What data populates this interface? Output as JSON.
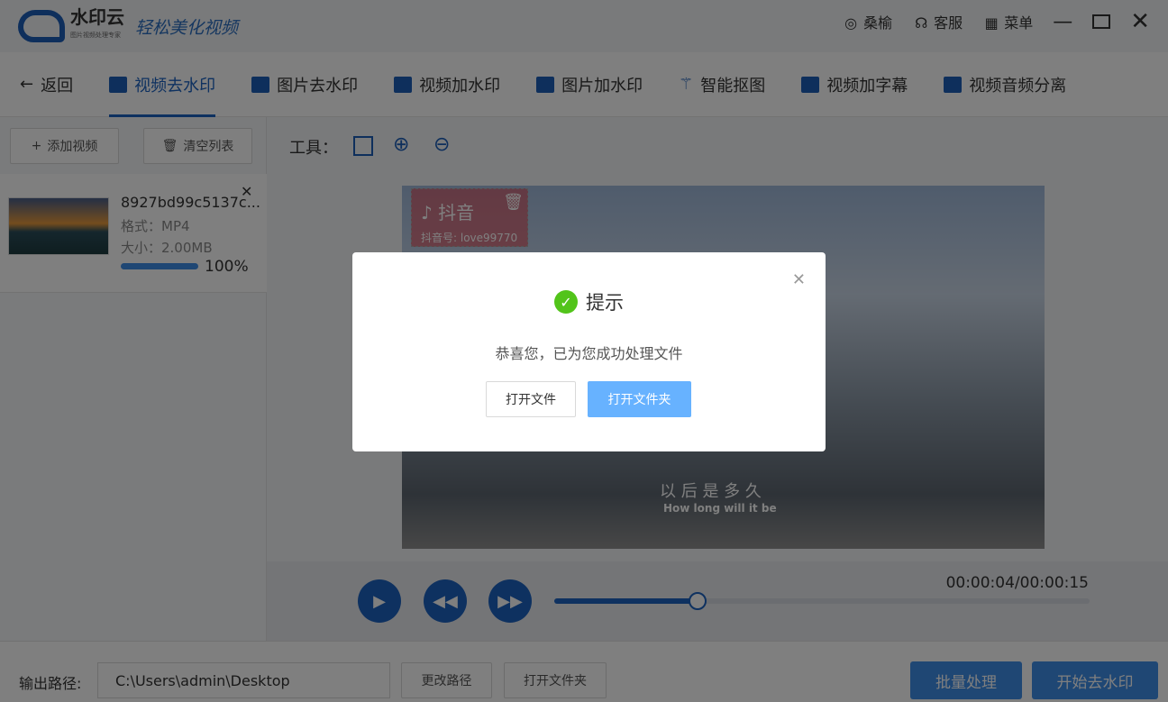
{
  "app": {
    "brand": "水印云",
    "brand_sub": "图片视频处理专家",
    "slogan": "轻松美化视频"
  },
  "topbar": {
    "user": "桑榆",
    "service": "客服",
    "menu": "菜单"
  },
  "nav": {
    "back": "返回",
    "tabs": [
      {
        "label": "视频去水印",
        "active": true
      },
      {
        "label": "图片去水印"
      },
      {
        "label": "视频加水印"
      },
      {
        "label": "图片加水印"
      },
      {
        "label": "智能抠图"
      },
      {
        "label": "视频加字幕"
      },
      {
        "label": "视频音频分离"
      }
    ]
  },
  "sidebar": {
    "add": "添加视频",
    "clear": "清空列表",
    "file": {
      "name": "8927bd99c5137c...",
      "format": "格式：MP4",
      "size": "大小：2.00MB",
      "progress": 100,
      "progress_label": "100%"
    }
  },
  "toolbar": {
    "label": "工具："
  },
  "video": {
    "watermark_title": "抖音",
    "watermark_id": "抖音号: love99770",
    "subtitle_cn": "以 后 是 多 久",
    "subtitle_en": "How long will it be"
  },
  "player": {
    "time": "00:00:04/00:00:15",
    "progress": 0.267
  },
  "bottom": {
    "output_label": "输出路径:",
    "path": "C:\\Users\\admin\\Desktop",
    "change": "更改路径",
    "open_folder": "打开文件夹",
    "batch": "批量处理",
    "start": "开始去水印"
  },
  "dialog": {
    "title": "提示",
    "message": "恭喜您，已为您成功处理文件",
    "open_file": "打开文件",
    "open_folder": "打开文件夹",
    "accent": "#67b2ff",
    "success": "#52c41a"
  }
}
